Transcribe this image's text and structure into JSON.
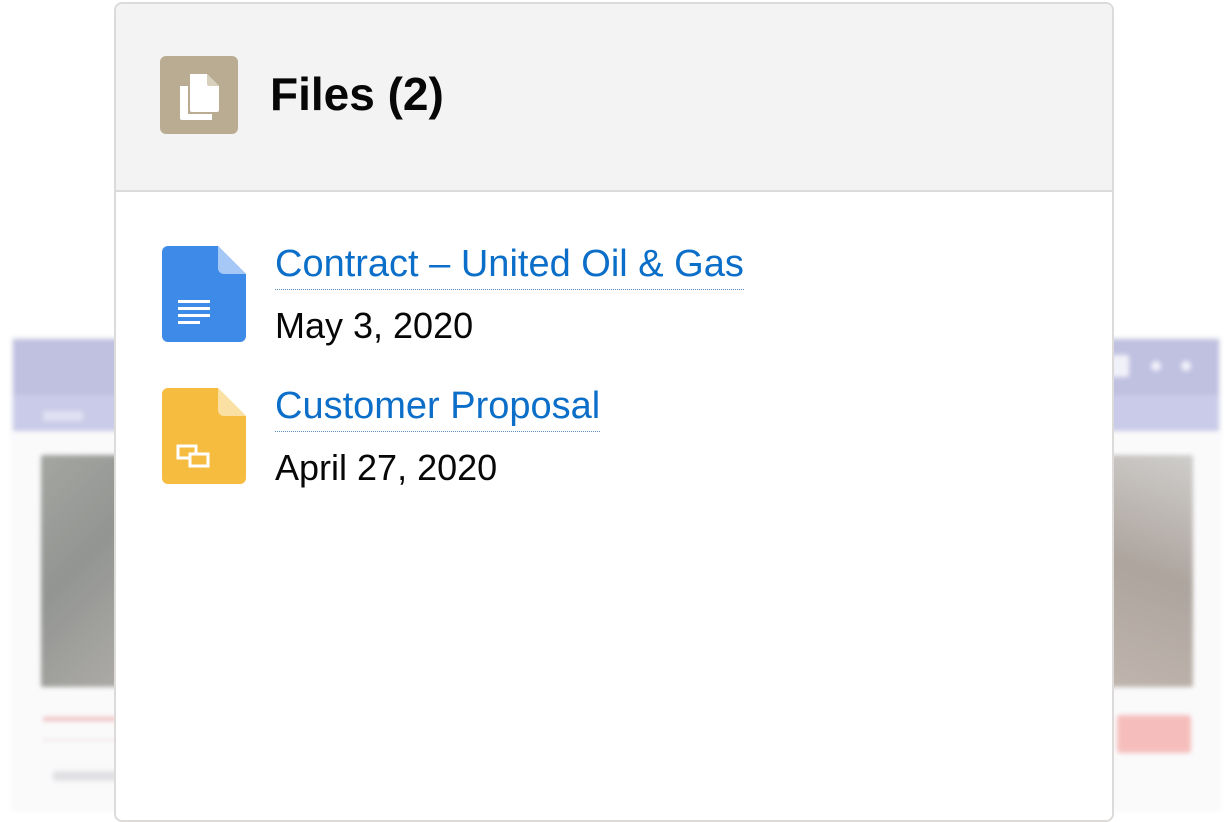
{
  "card": {
    "title": "Files (2)",
    "header_icon": "files-icon"
  },
  "files": [
    {
      "name": "Contract – United Oil & Gas",
      "date": "May 3, 2020",
      "icon": "google-doc-icon",
      "icon_color": "#3d8ae8"
    },
    {
      "name": "Customer Proposal",
      "date": "April 27, 2020",
      "icon": "google-slides-icon",
      "icon_color": "#f5bc3f"
    }
  ],
  "colors": {
    "link": "#0b6ec8",
    "header_bg": "#f3f3f3",
    "header_icon_bg": "#baac93",
    "background_app_bar": "#8d8fc9",
    "background_alert": "#ee8a86"
  }
}
